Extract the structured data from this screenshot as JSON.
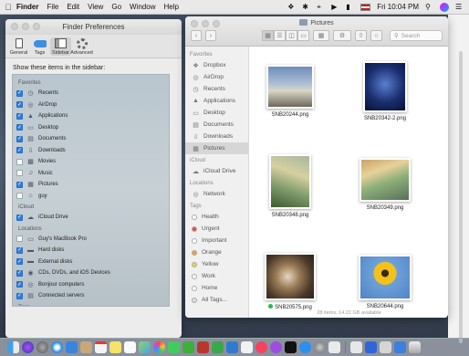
{
  "menubar": {
    "app": "Finder",
    "items": [
      "File",
      "Edit",
      "View",
      "Go",
      "Window",
      "Help"
    ],
    "clock": "Fri 10:04 PM"
  },
  "prefs": {
    "title": "Finder Preferences",
    "tabs": [
      "General",
      "Tags",
      "Sidebar",
      "Advanced"
    ],
    "active_tab": "Sidebar",
    "heading": "Show these items in the sidebar:",
    "sections": [
      {
        "label": "Favorites",
        "items": [
          {
            "label": "Recents",
            "checked": true,
            "icon": "recents-icon"
          },
          {
            "label": "AirDrop",
            "checked": true,
            "icon": "airdrop-icon"
          },
          {
            "label": "Applications",
            "checked": true,
            "icon": "applications-icon"
          },
          {
            "label": "Desktop",
            "checked": true,
            "icon": "desktop-icon"
          },
          {
            "label": "Documents",
            "checked": true,
            "icon": "documents-icon"
          },
          {
            "label": "Downloads",
            "checked": true,
            "icon": "downloads-icon"
          },
          {
            "label": "Movies",
            "checked": false,
            "icon": "movies-icon"
          },
          {
            "label": "Music",
            "checked": false,
            "icon": "music-icon"
          },
          {
            "label": "Pictures",
            "checked": true,
            "icon": "pictures-icon"
          },
          {
            "label": "guy",
            "checked": false,
            "icon": "home-icon"
          }
        ]
      },
      {
        "label": "iCloud",
        "items": [
          {
            "label": "iCloud Drive",
            "checked": true,
            "icon": "cloud-icon"
          }
        ]
      },
      {
        "label": "Locations",
        "items": [
          {
            "label": "Guy's MacBook Pro",
            "checked": false,
            "icon": "laptop-icon"
          },
          {
            "label": "Hard disks",
            "checked": true,
            "icon": "hard-disk-icon"
          },
          {
            "label": "External disks",
            "checked": true,
            "icon": "external-disk-icon"
          },
          {
            "label": "CDs, DVDs, and iOS Devices",
            "checked": true,
            "icon": "disc-icon"
          },
          {
            "label": "Bonjour computers",
            "checked": true,
            "icon": "bonjour-icon"
          },
          {
            "label": "Connected servers",
            "checked": true,
            "icon": "server-icon"
          }
        ]
      },
      {
        "label": "Tags",
        "items": [
          {
            "label": "Recent Tags",
            "checked": true,
            "icon": "tag-icon"
          }
        ]
      }
    ]
  },
  "finder": {
    "title": "Pictures",
    "search_placeholder": "Search",
    "sidebar": {
      "favorites_label": "Favorites",
      "favorites": [
        {
          "label": "Dropbox",
          "icon": "dropbox-icon"
        },
        {
          "label": "AirDrop",
          "icon": "airdrop-icon"
        },
        {
          "label": "Recents",
          "icon": "recents-icon"
        },
        {
          "label": "Applications",
          "icon": "applications-icon"
        },
        {
          "label": "Desktop",
          "icon": "desktop-icon"
        },
        {
          "label": "Documents",
          "icon": "documents-icon"
        },
        {
          "label": "Downloads",
          "icon": "downloads-icon"
        },
        {
          "label": "Pictures",
          "icon": "pictures-icon",
          "selected": true
        }
      ],
      "icloud_label": "iCloud",
      "icloud": [
        {
          "label": "iCloud Drive",
          "icon": "cloud-icon"
        }
      ],
      "locations_label": "Locations",
      "locations": [
        {
          "label": "Network",
          "icon": "network-icon"
        }
      ],
      "tags_label": "Tags",
      "tags": [
        {
          "label": "Health",
          "color": "#ffffff"
        },
        {
          "label": "Urgent",
          "color": "#f04a3f"
        },
        {
          "label": "Important",
          "color": "#ffffff"
        },
        {
          "label": "Orange",
          "color": "#f5a02a"
        },
        {
          "label": "Yellow",
          "color": "#f5cf2c"
        },
        {
          "label": "Work",
          "color": "#ffffff"
        },
        {
          "label": "Home",
          "color": "#ffffff"
        },
        {
          "label": "All Tags...",
          "color": "#dddddd"
        }
      ]
    },
    "files": [
      {
        "name": "SNB20244.png",
        "tag": false
      },
      {
        "name": "SNB20342-2.png",
        "tag": false
      },
      {
        "name": "SNB20348.png",
        "tag": false
      },
      {
        "name": "SNB20349.png",
        "tag": false
      },
      {
        "name": "SNB20575.png",
        "tag": true
      },
      {
        "name": "SNB20644.png",
        "tag": false
      }
    ],
    "status": "28 items, 14.22 GB available"
  },
  "colors": {
    "accent": "#2d7fe2"
  }
}
